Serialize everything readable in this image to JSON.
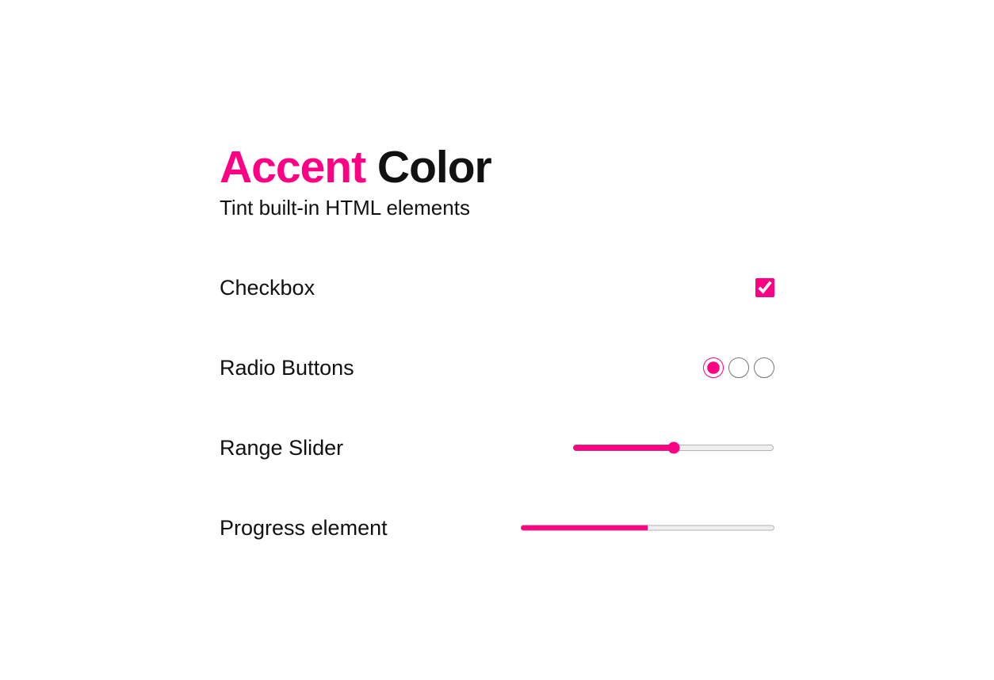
{
  "title": {
    "accent_word": "Accent",
    "rest": " Color"
  },
  "subtitle": "Tint built-in HTML elements",
  "accent_color": "#ff0084",
  "rows": {
    "checkbox": {
      "label": "Checkbox",
      "checked": true
    },
    "radio": {
      "label": "Radio Buttons",
      "options": [
        {
          "checked": true
        },
        {
          "checked": false
        },
        {
          "checked": false
        }
      ]
    },
    "range": {
      "label": "Range Slider",
      "min": 0,
      "max": 100,
      "value": 50
    },
    "progress": {
      "label": "Progress element",
      "max": 100,
      "value": 50
    }
  }
}
